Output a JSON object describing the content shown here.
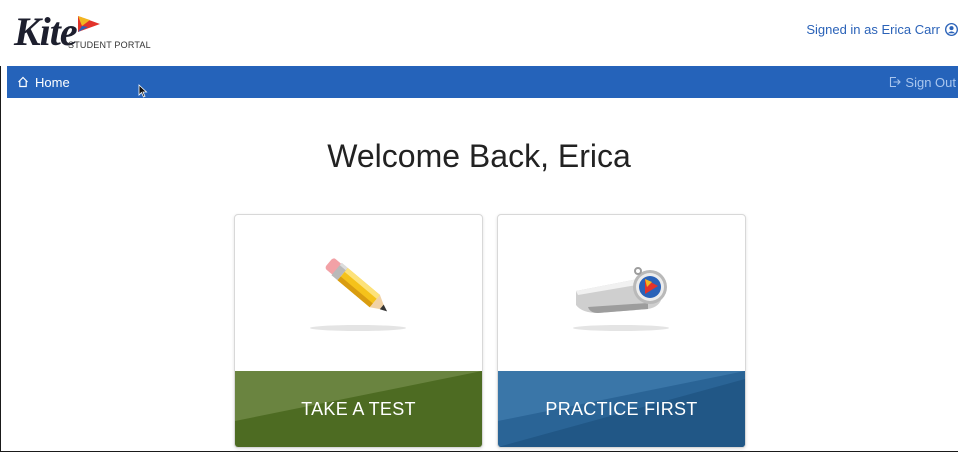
{
  "header": {
    "logo_word": "Kite",
    "logo_sub": "STUDENT PORTAL",
    "signed_in_text": "Signed in as Erica Carr"
  },
  "nav": {
    "home_label": "Home",
    "signout_label": "Sign Out"
  },
  "main": {
    "welcome": "Welcome Back, Erica",
    "cards": [
      {
        "label": "TAKE A TEST",
        "icon": "pencil-icon",
        "color": "#4d6b22"
      },
      {
        "label": "PRACTICE FIRST",
        "icon": "whistle-icon",
        "color": "#2a6496"
      }
    ]
  },
  "colors": {
    "navbar": "#2563ba",
    "signed_in": "#2a62b8",
    "test_green": "#4d6b22",
    "practice_blue": "#2a6496"
  }
}
